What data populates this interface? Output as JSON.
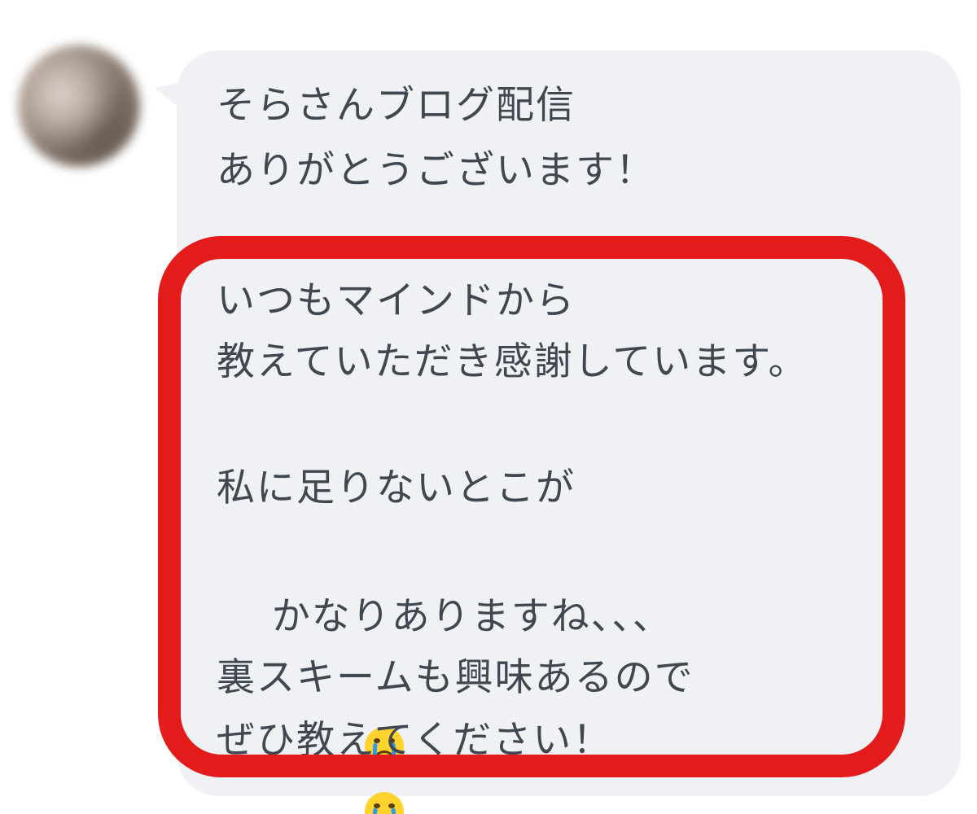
{
  "message": {
    "line1": "そらさんブログ配信",
    "line2": "ありがとうございます！",
    "line3": "いつもマインドから",
    "line4": "教えていただき感謝しています。",
    "line5": "私に足りないとこが",
    "line6": "かなりありますね、、、",
    "line7": "裏スキームも興味あるので",
    "line8": "ぜひ教えてください！"
  },
  "colors": {
    "bubble": "#f0f1f4",
    "text": "#3f4751",
    "highlight": "#e31b1b"
  },
  "icons": [
    "avatar-blurred",
    "crying-face-emoji",
    "crying-face-emoji"
  ]
}
